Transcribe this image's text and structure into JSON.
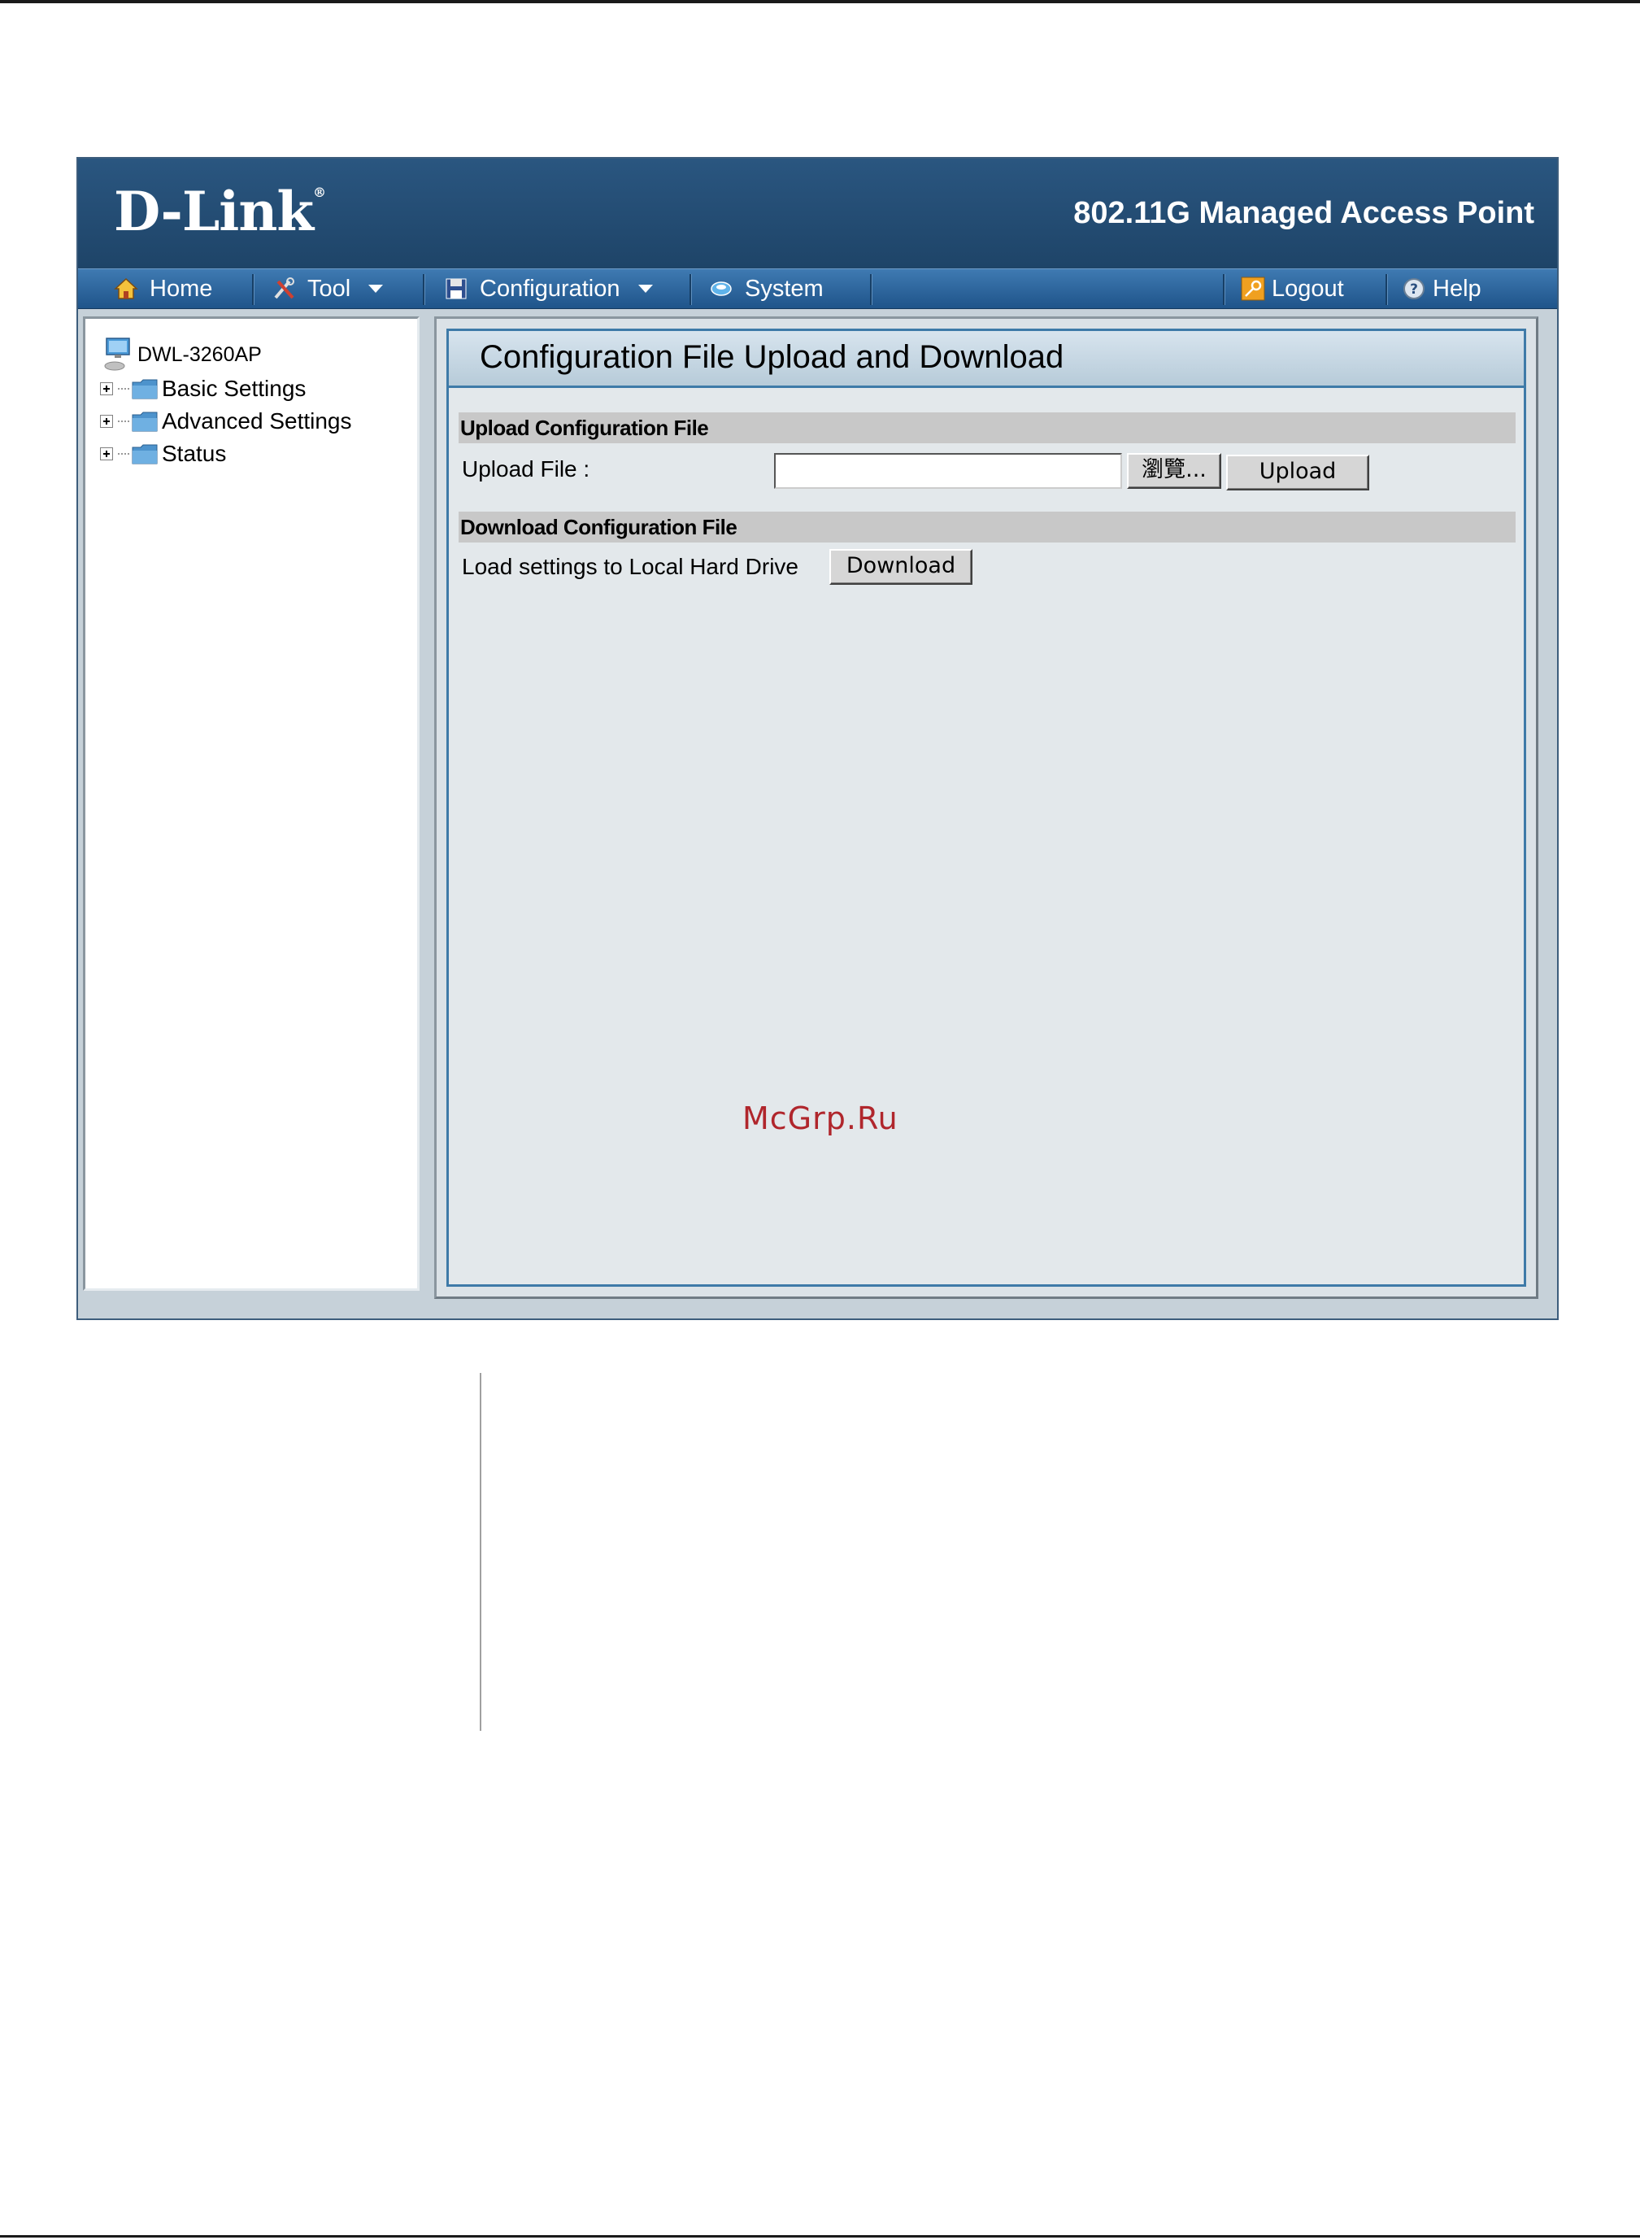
{
  "header": {
    "logo_text": "D-Link",
    "logo_mark": "®",
    "product_title": "802.11G Managed Access Point"
  },
  "nav": {
    "home": {
      "label": "Home",
      "icon": "home-icon"
    },
    "tool": {
      "label": "Tool",
      "icon": "tool-icon"
    },
    "configuration": {
      "label": "Configuration",
      "icon": "disk-icon"
    },
    "system": {
      "label": "System",
      "icon": "system-icon"
    },
    "logout": {
      "label": "Logout",
      "icon": "key-icon"
    },
    "help": {
      "label": "Help",
      "icon": "help-icon"
    }
  },
  "tree": {
    "root": "DWL-3260AP",
    "items": [
      {
        "label": "Basic Settings"
      },
      {
        "label": "Advanced Settings"
      },
      {
        "label": "Status"
      }
    ]
  },
  "main": {
    "title": "Configuration File Upload and Download",
    "upload": {
      "section_title": "Upload Configuration File",
      "field_label": "Upload File :",
      "field_value": "",
      "browse_label": "瀏覽...",
      "upload_label": "Upload"
    },
    "download": {
      "section_title": "Download Configuration File",
      "row_label": "Load settings to Local Hard Drive",
      "download_label": "Download"
    }
  },
  "watermark": "McGrp.Ru",
  "colors": {
    "header_bg": "#1e4468",
    "nav_bg": "#2f68a0",
    "panel_border": "#3e7aa8",
    "watermark": "#b0262c"
  }
}
